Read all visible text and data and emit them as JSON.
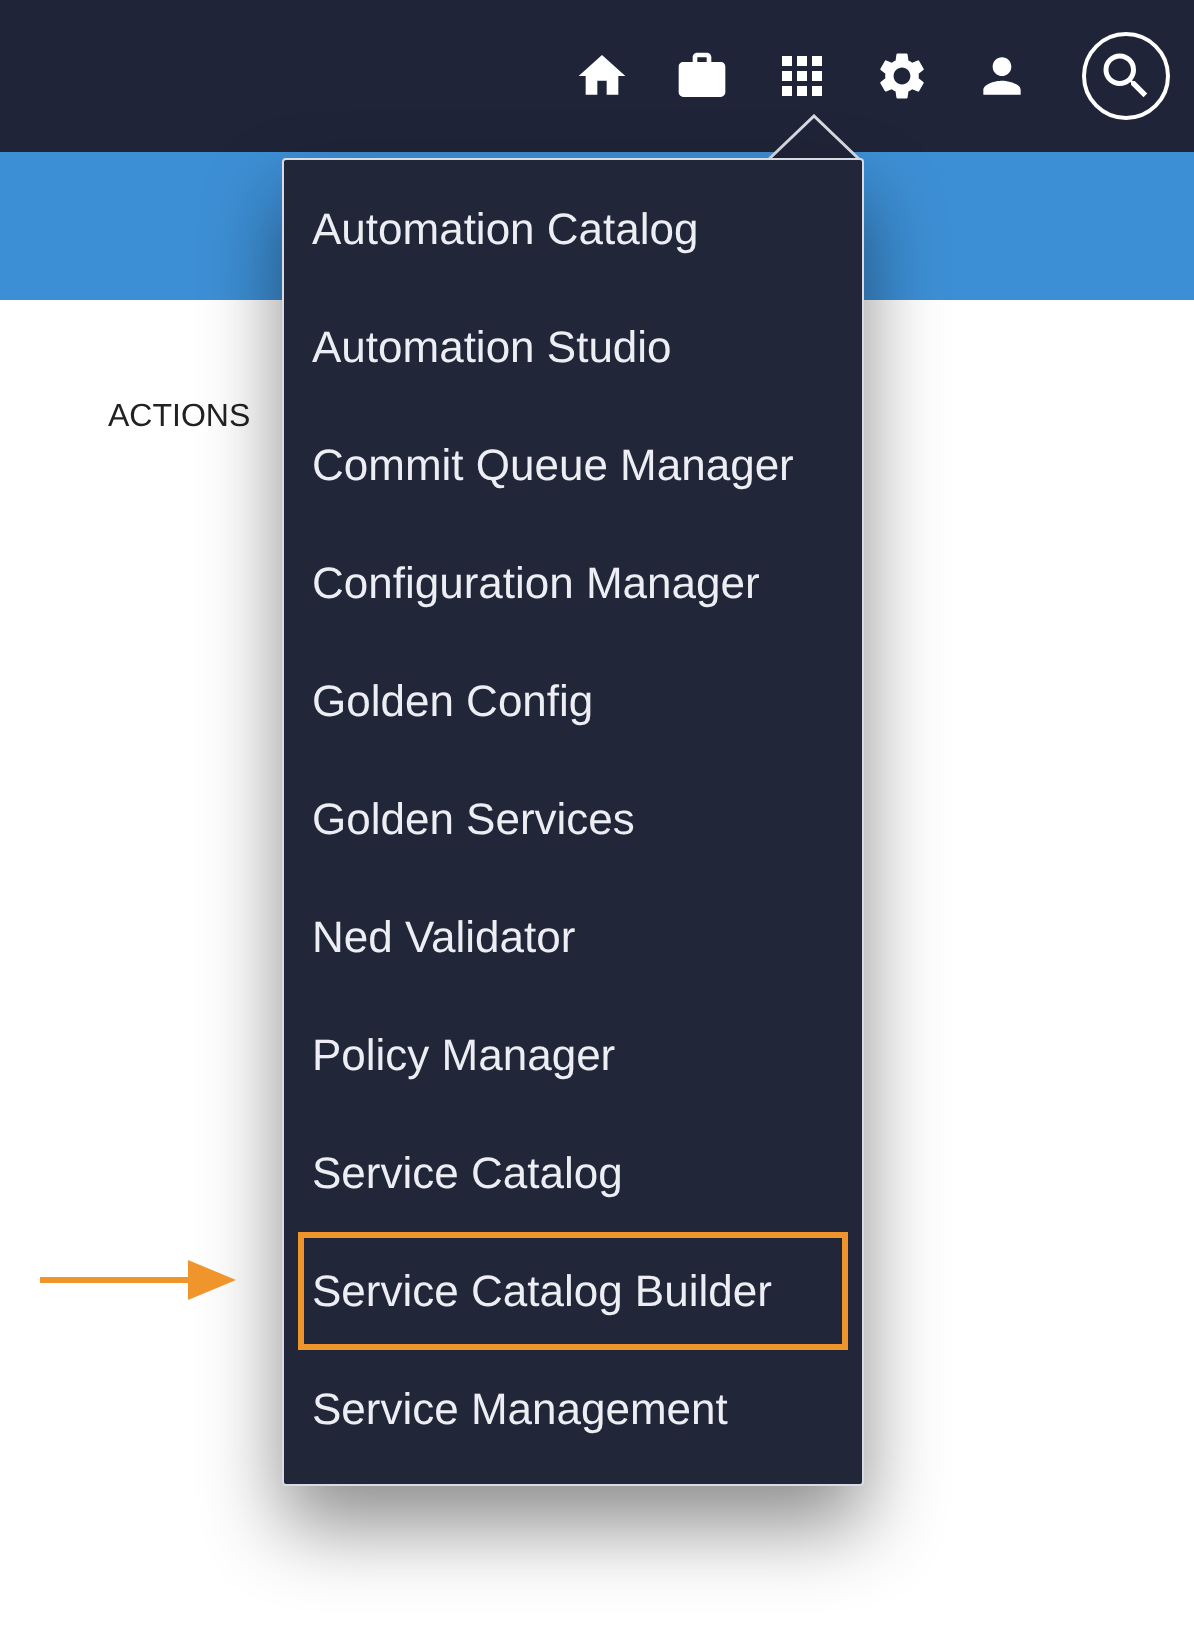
{
  "actions_label": "ACTIONS",
  "app_menu": {
    "items": [
      {
        "label": "Automation Catalog",
        "highlighted": false
      },
      {
        "label": "Automation Studio",
        "highlighted": false
      },
      {
        "label": "Commit Queue Manager",
        "highlighted": false
      },
      {
        "label": "Configuration Manager",
        "highlighted": false
      },
      {
        "label": "Golden Config",
        "highlighted": false
      },
      {
        "label": "Golden Services",
        "highlighted": false
      },
      {
        "label": "Ned Validator",
        "highlighted": false
      },
      {
        "label": "Policy Manager",
        "highlighted": false
      },
      {
        "label": "Service Catalog",
        "highlighted": false
      },
      {
        "label": "Service Catalog Builder",
        "highlighted": true
      },
      {
        "label": "Service Management",
        "highlighted": false
      }
    ]
  }
}
